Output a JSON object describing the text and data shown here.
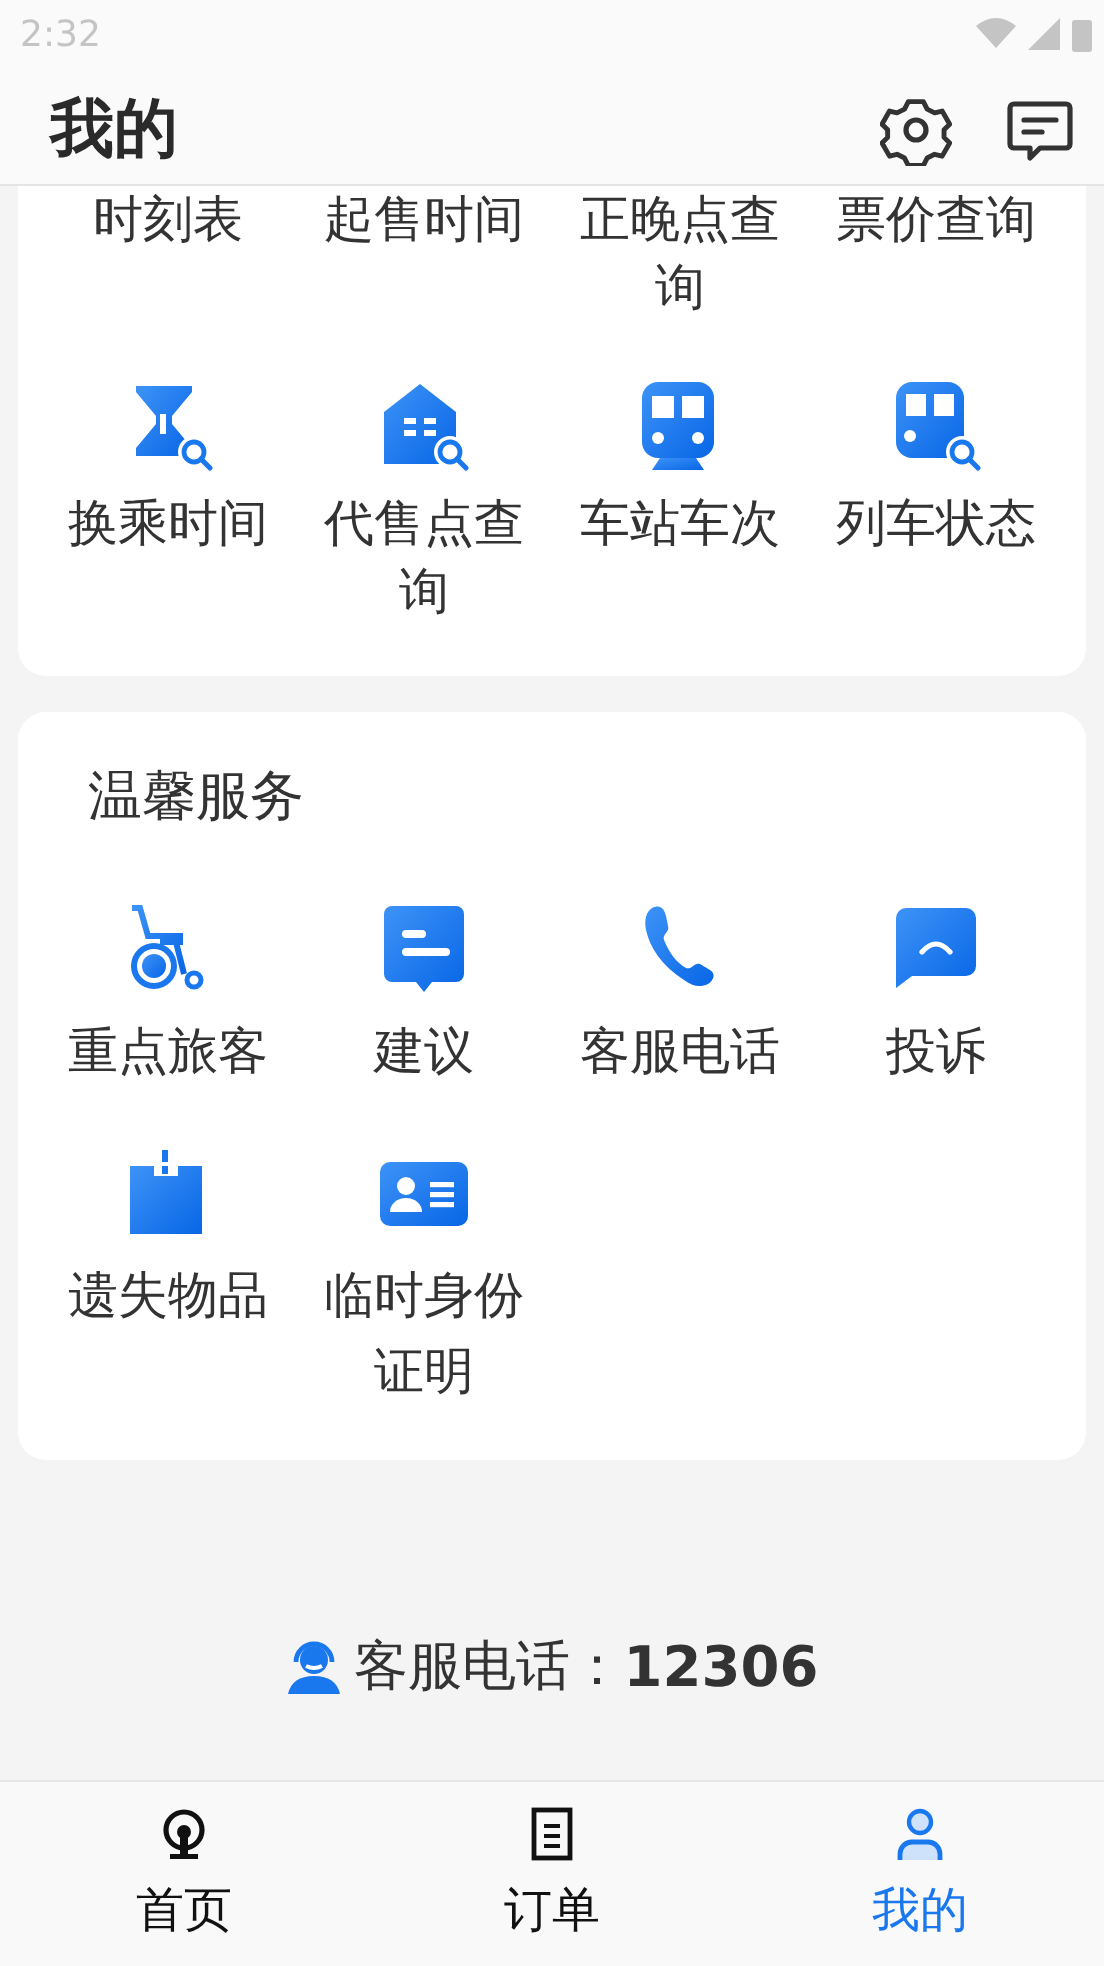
{
  "status_bar": {
    "time": "2:32"
  },
  "header": {
    "title": "我的"
  },
  "sections": [
    {
      "items": [
        {
          "label": "时刻表",
          "kind": "text"
        },
        {
          "label": "起售时间",
          "kind": "text"
        },
        {
          "label": "正晚点查询",
          "kind": "text"
        },
        {
          "label": "票价查询",
          "kind": "text"
        },
        {
          "label": "换乘时间",
          "kind": "icon"
        },
        {
          "label": "代售点查询",
          "kind": "icon"
        },
        {
          "label": "车站车次",
          "kind": "icon"
        },
        {
          "label": "列车状态",
          "kind": "icon"
        }
      ]
    },
    {
      "title": "温馨服务",
      "items": [
        {
          "label": "重点旅客",
          "kind": "icon"
        },
        {
          "label": "建议",
          "kind": "icon"
        },
        {
          "label": "客服电话",
          "kind": "icon"
        },
        {
          "label": "投诉",
          "kind": "icon"
        },
        {
          "label": "遗失物品",
          "kind": "icon"
        },
        {
          "label": "临时身份证明",
          "kind": "icon"
        }
      ]
    }
  ],
  "footer": {
    "label": "客服电话：",
    "phone": "12306"
  },
  "tab_bar": [
    {
      "label": "首页",
      "selected": false
    },
    {
      "label": "订单",
      "selected": false
    },
    {
      "label": "我的",
      "selected": true
    }
  ]
}
